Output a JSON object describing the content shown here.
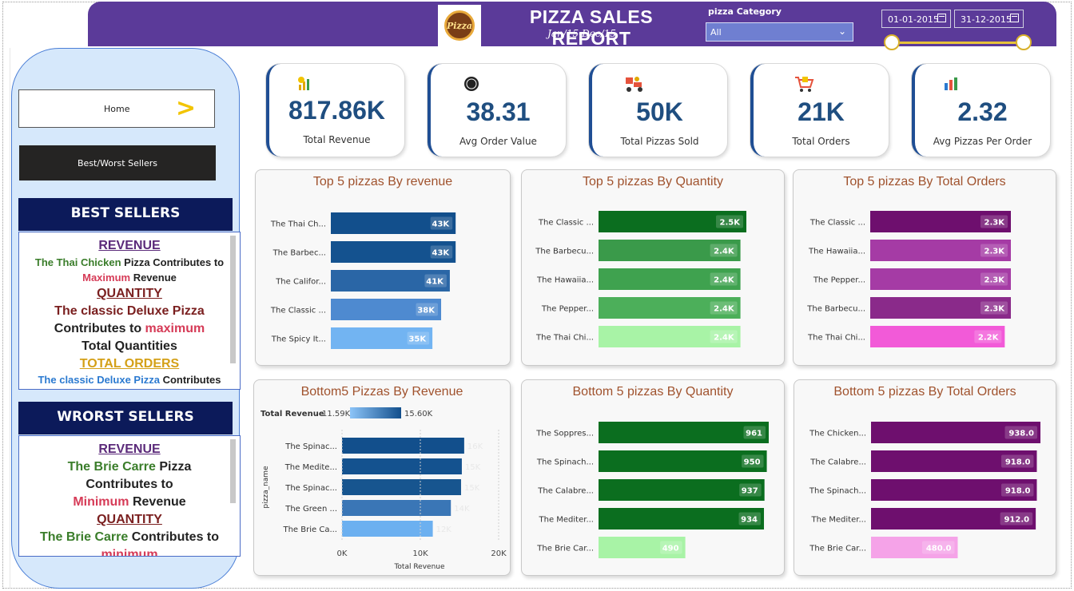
{
  "header": {
    "title": "PIZZA SALES REPORT",
    "subtitle": "Jan/15-Dec/15",
    "logo_text": "Pizza",
    "filter_label": "pizza Category",
    "filter_value": "All",
    "date_start": "01-01-2015",
    "date_end": "31-12-2015"
  },
  "nav": {
    "home_label": "Home",
    "best_worst_label": "Best/Worst Sellers"
  },
  "best": {
    "heading": "BEST SELLERS",
    "revenue_title": "REVENUE",
    "revenue_p1": "The Thai Chicken",
    "revenue_p2": " Pizza Contributes to",
    "revenue_p3": "Maximum",
    "revenue_p4": " Revenue",
    "quantity_title": "QUANTITY",
    "quantity_p1": "The classic Deluxe Pizza",
    "quantity_p2": "Contributes to ",
    "quantity_p3": "maximum",
    "quantity_p4": "Total Quantities",
    "orders_title": "TOTAL ORDERS",
    "orders_p1": "The classic Deluxe Pizza",
    "orders_p2": " Contributes"
  },
  "worst": {
    "heading": "WRORST SELLERS",
    "revenue_title": "REVENUE",
    "revenue_p1": "The Brie Carre",
    "revenue_p2": " Pizza",
    "revenue_p3": "Contributes to",
    "revenue_p4": "Minimum",
    "revenue_p5": " Revenue",
    "quantity_title": "QUANTITY",
    "quantity_p1": "The Brie Carre",
    "quantity_p2": " Contributes to",
    "quantity_p3": "minimum"
  },
  "kpis": [
    {
      "value": "817.86K",
      "label": "Total Revenue",
      "icon": "money-bag-chart-icon"
    },
    {
      "value": "38.31",
      "label": "Avg Order Value",
      "icon": "badge-icon"
    },
    {
      "value": "50K",
      "label": "Total Pizzas Sold",
      "icon": "delivery-scooter-icon"
    },
    {
      "value": "21K",
      "label": "Total Orders",
      "icon": "shopping-cart-icon"
    },
    {
      "value": "2.32",
      "label": "Avg Pizzas Per Order",
      "icon": "bar-chart-icon"
    }
  ],
  "colors": {
    "header": "#5b3a99",
    "blue_dark": "#124f8c",
    "green_dark": "#0b6e1f",
    "purple_dark": "#6e0f6e",
    "title_brown": "#a0522d"
  },
  "chart_data": [
    {
      "type": "bar",
      "orientation": "horizontal",
      "title": "Top 5 pizzas By revenue",
      "categories": [
        "The Thai Ch...",
        "The Barbec...",
        "The Califor...",
        "The Classic ...",
        "The Spicy It..."
      ],
      "values": [
        43,
        43,
        41,
        38,
        35
      ],
      "labels": [
        "43K",
        "43K",
        "41K",
        "38K",
        "35K"
      ],
      "colors": [
        "#124f8c",
        "#14528f",
        "#2a66a6",
        "#4e8ad0",
        "#72b4f2"
      ],
      "max": 43.5
    },
    {
      "type": "bar",
      "orientation": "horizontal",
      "title": "Top 5 pizzas By Quantity",
      "categories": [
        "The Classic ...",
        "The Barbecu...",
        "The Hawaiia...",
        "The Pepper...",
        "The Thai Chi..."
      ],
      "values": [
        2.5,
        2.4,
        2.4,
        2.4,
        2.4
      ],
      "labels": [
        "2.5K",
        "2.4K",
        "2.4K",
        "2.4K",
        "2.4K"
      ],
      "colors": [
        "#0b6e1f",
        "#3a9a4a",
        "#3fa24f",
        "#4caf5a",
        "#a8f3a6"
      ],
      "max": 2.5
    },
    {
      "type": "bar",
      "orientation": "horizontal",
      "title": "Top 5 pizzas By Total Orders",
      "categories": [
        "The Classic ...",
        "The Hawaiia...",
        "The Pepper...",
        "The Barbecu...",
        "The Thai Chi..."
      ],
      "values": [
        2.3,
        2.3,
        2.3,
        2.3,
        2.2
      ],
      "labels": [
        "2.3K",
        "2.3K",
        "2.3K",
        "2.3K",
        "2.2K"
      ],
      "colors": [
        "#6e0f6e",
        "#a53ba5",
        "#a53ba5",
        "#8a2a8a",
        "#f25ad8"
      ],
      "max": 2.3
    },
    {
      "type": "bar",
      "orientation": "horizontal",
      "title": "Bottom5 Pizzas By Revenue",
      "legend_label": "Total Revenue",
      "legend_min": "11.59K",
      "legend_max": "15.60K",
      "categories": [
        "The Spinac...",
        "The Medite...",
        "The Spinac...",
        "The Green ...",
        "The Brie Ca..."
      ],
      "values": [
        15.6,
        15.3,
        15.2,
        13.9,
        11.59
      ],
      "labels": [
        "16K",
        "15K",
        "15K",
        "14K",
        "12K"
      ],
      "colors": [
        "#124f8c",
        "#14528f",
        "#17558f",
        "#3a76b6",
        "#6cb0f0"
      ],
      "xlabel": "Total Revenue",
      "ylabel": "pizza_name",
      "xticks": [
        "0K",
        "10K",
        "20K"
      ],
      "xlim": [
        0,
        20
      ]
    },
    {
      "type": "bar",
      "orientation": "horizontal",
      "title": "Bottom 5 pizzas By Quantity",
      "categories": [
        "The Soppres...",
        "The Spinach...",
        "The Calabre...",
        "The Mediter...",
        "The Brie Car..."
      ],
      "values": [
        961,
        950,
        937,
        934,
        490
      ],
      "labels": [
        "961",
        "950",
        "937",
        "934",
        "490"
      ],
      "colors": [
        "#0b6e1f",
        "#0b6e1f",
        "#0b6e1f",
        "#0b6e1f",
        "#a8f3a6"
      ],
      "max": 961
    },
    {
      "type": "bar",
      "orientation": "horizontal",
      "title": "Bottom 5 pizzas By Total Orders",
      "categories": [
        "The Chicken...",
        "The Calabre...",
        "The Spinach...",
        "The Mediter...",
        "The Brie Car..."
      ],
      "values": [
        938,
        918,
        918,
        912,
        480
      ],
      "labels": [
        "938.0",
        "918.0",
        "918.0",
        "912.0",
        "480.0"
      ],
      "colors": [
        "#6e0f6e",
        "#6e0f6e",
        "#6e0f6e",
        "#6e0f6e",
        "#f5a3e8"
      ],
      "max": 938
    }
  ]
}
